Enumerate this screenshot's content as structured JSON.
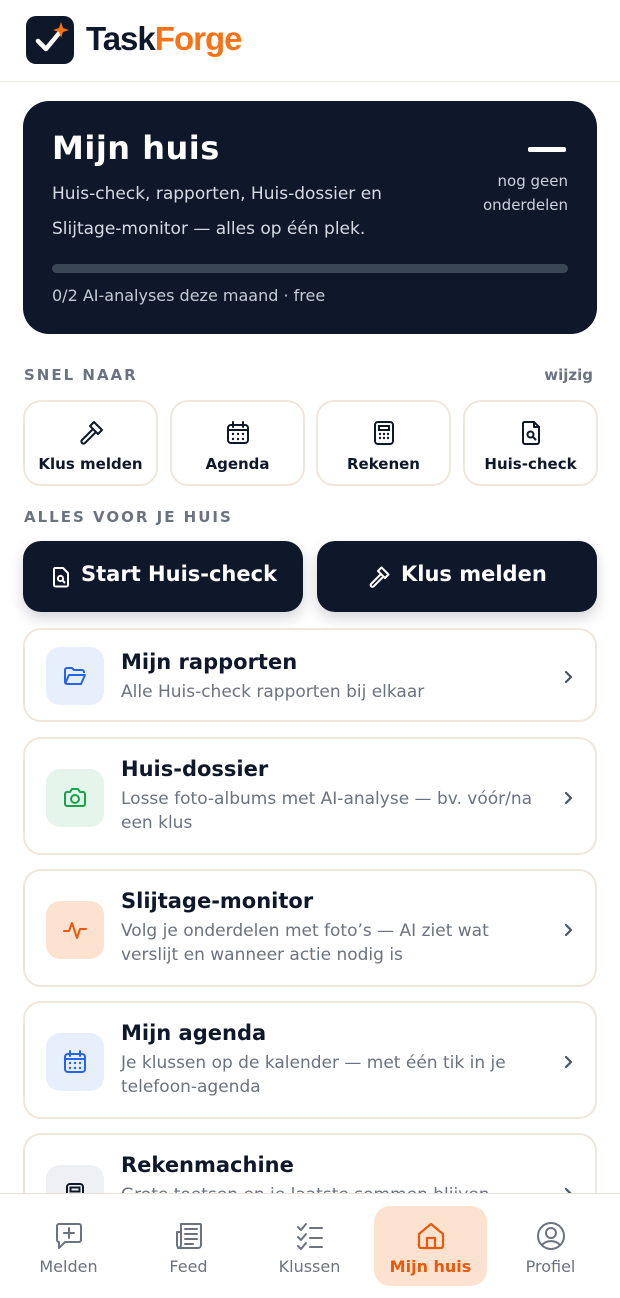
{
  "header": {
    "brand_part1": "Task",
    "brand_part2": "Forge",
    "logo_icon": "check-sparkle-icon"
  },
  "hero": {
    "title": "Mijn huis",
    "subtitle": "Huis-check, rapporten, Huis-dossier en Slijtage-monitor — alles op één plek.",
    "status": "nog geen onderdelen",
    "usage": "0/2 AI-analyses deze maand · free",
    "progress": 0
  },
  "quick": {
    "label": "SNEL NAAR",
    "edit": "wijzig",
    "tiles": [
      {
        "label": "Klus melden",
        "icon": "hammer-icon"
      },
      {
        "label": "Agenda",
        "icon": "calendar-icon"
      },
      {
        "label": "Rekenen",
        "icon": "calculator-icon"
      },
      {
        "label": "Huis-check",
        "icon": "document-search-icon"
      }
    ]
  },
  "all": {
    "label": "ALLES VOOR JE HUIS",
    "primary": {
      "label": "Start Huis-check",
      "icon": "document-search-icon"
    },
    "secondary": {
      "label": "Klus melden",
      "icon": "hammer-icon"
    }
  },
  "cards": [
    {
      "title": "Mijn rapporten",
      "desc": "Alle Huis-check rapporten bij elkaar",
      "icon": "folder-icon",
      "color": "#2563eb"
    },
    {
      "title": "Huis-dossier",
      "desc": "Losse foto-albums met AI-analyse — bv. vóór/na een klus",
      "icon": "camera-icon",
      "color": "#16a34a"
    },
    {
      "title": "Slijtage-monitor",
      "desc": "Volg je onderdelen met foto’s — AI ziet wat verslijt en wanneer actie nodig is",
      "icon": "pulse-icon",
      "color": "#ea580c"
    },
    {
      "title": "Mijn agenda",
      "desc": "Je klussen op de kalender — met één tik in je telefoon-agenda",
      "icon": "calendar-icon",
      "color": "#2563eb"
    },
    {
      "title": "Rekenmachine",
      "desc": "Grote toetsen en je laatste sommen blijven",
      "icon": "calculator-icon",
      "color": "#0f172a"
    }
  ],
  "nav": [
    {
      "label": "Melden",
      "icon": "message-plus-icon"
    },
    {
      "label": "Feed",
      "icon": "newspaper-icon"
    },
    {
      "label": "Klussen",
      "icon": "checklist-icon"
    },
    {
      "label": "Mijn huis",
      "icon": "home-icon",
      "active": true
    },
    {
      "label": "Profiel",
      "icon": "user-circle-icon"
    }
  ]
}
